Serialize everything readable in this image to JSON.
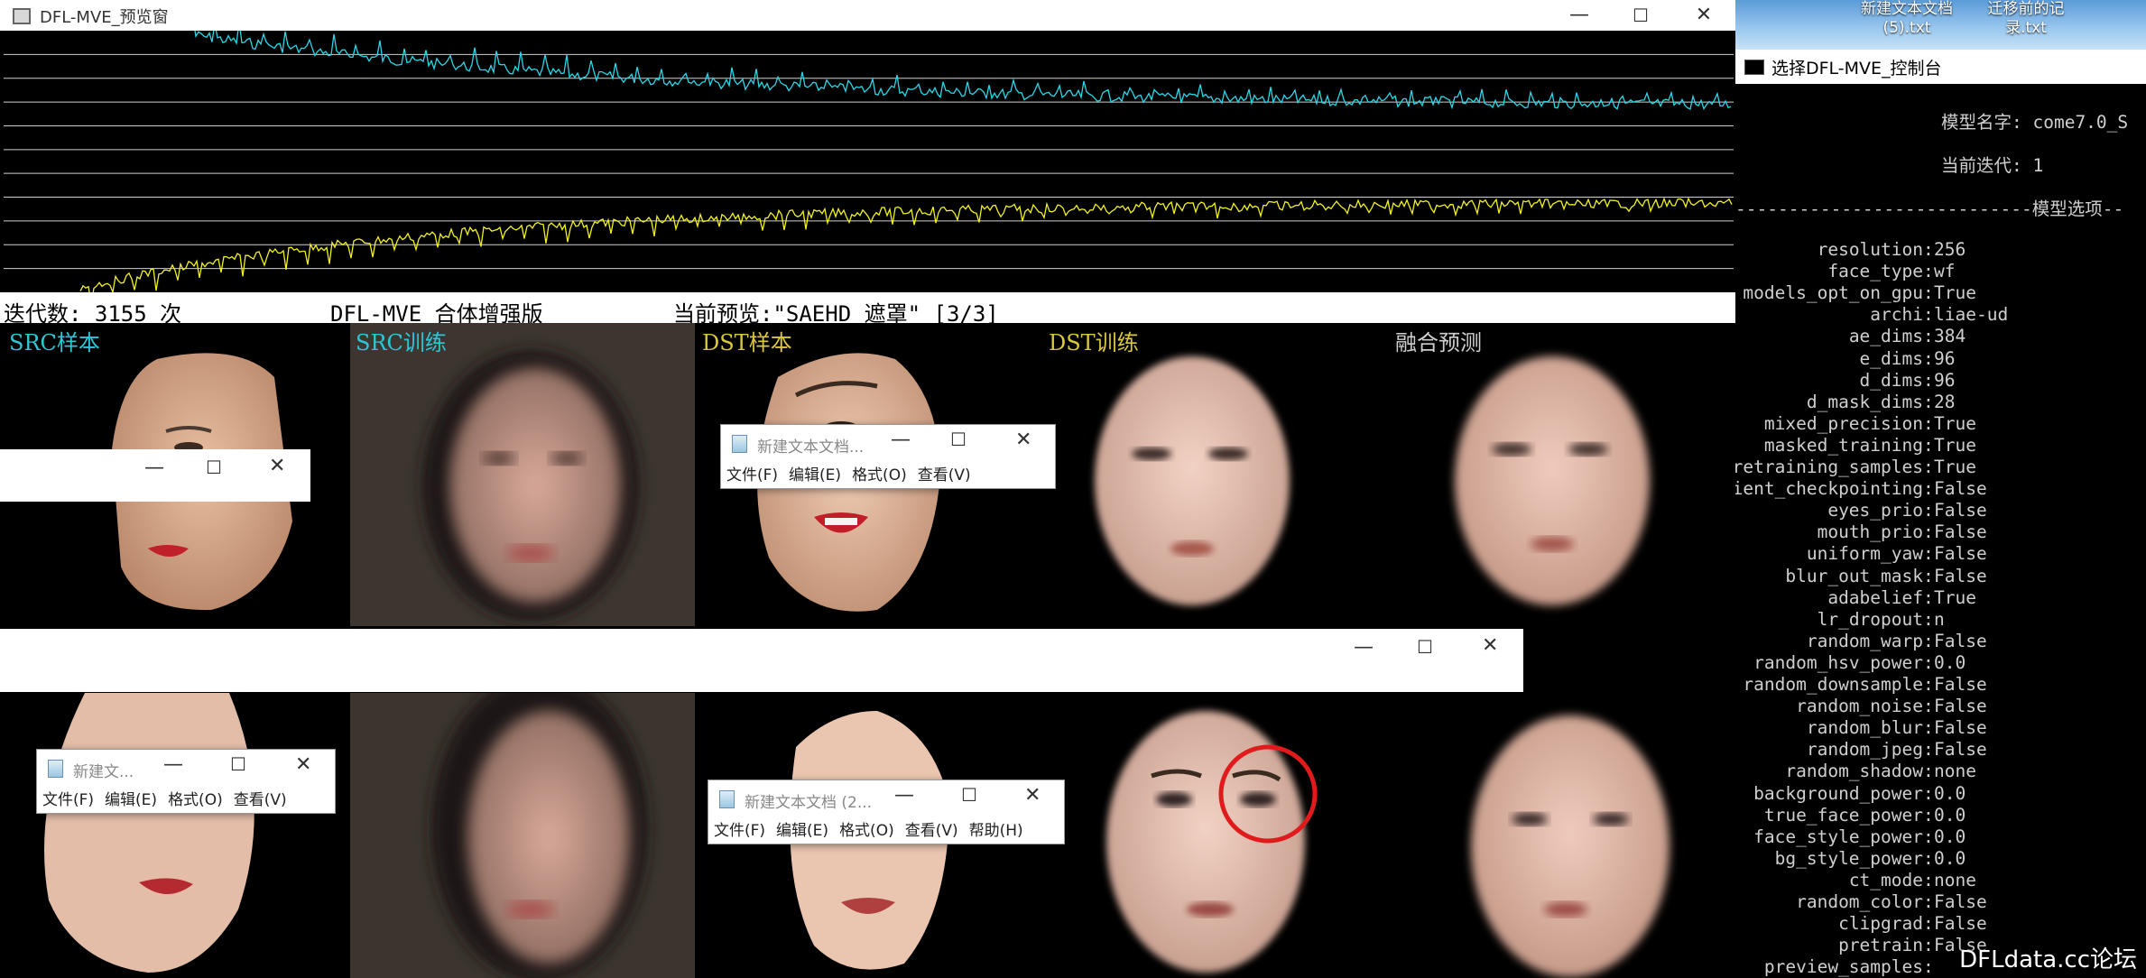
{
  "preview_window": {
    "title": "DFL-MVE_预览窗",
    "status": {
      "iterations": "迭代数: 3155 次",
      "edition": "DFL-MVE_合体增强版",
      "current_preview": "当前预览:\"SAEHD 遮罩\" [3/3]"
    },
    "columns": [
      {
        "label": "SRC样本",
        "color": "#2cc6d8"
      },
      {
        "label": "SRC训练",
        "color": "#2cc6d8"
      },
      {
        "label": "DST样本",
        "color": "#d9c83b"
      },
      {
        "label": "DST训练",
        "color": "#d9c83b"
      },
      {
        "label": "融合预测",
        "color": "#cfcfcf"
      }
    ],
    "graph": {
      "src_loss_color": "#27d8e8",
      "dst_loss_color": "#f2f21e",
      "gridlines": 10
    }
  },
  "console_window": {
    "title": "选择DFL-MVE_控制台",
    "model_name": "模型名字: come7.0_S",
    "current_iteration": "当前迭代: 1",
    "section_header": "----------------------------模型选项--",
    "options": [
      {
        "key": "resolution",
        "value": "256"
      },
      {
        "key": "face_type",
        "value": "wf"
      },
      {
        "key": "models_opt_on_gpu",
        "value": "True"
      },
      {
        "key": "archi",
        "value": "liae-ud"
      },
      {
        "key": "ae_dims",
        "value": "384"
      },
      {
        "key": "e_dims",
        "value": "96"
      },
      {
        "key": "d_dims",
        "value": "96"
      },
      {
        "key": "d_mask_dims",
        "value": "28"
      },
      {
        "key": "mixed_precision",
        "value": "True"
      },
      {
        "key": "masked_training",
        "value": "True"
      },
      {
        "key": "retraining_samples",
        "value": "True"
      },
      {
        "key": "gradient_checkpointing",
        "value": "False"
      },
      {
        "key": "eyes_prio",
        "value": "False"
      },
      {
        "key": "mouth_prio",
        "value": "False"
      },
      {
        "key": "uniform_yaw",
        "value": "False"
      },
      {
        "key": "blur_out_mask",
        "value": "False"
      },
      {
        "key": "adabelief",
        "value": "True"
      },
      {
        "key": "lr_dropout",
        "value": "n"
      },
      {
        "key": "random_warp",
        "value": "False"
      },
      {
        "key": "random_hsv_power",
        "value": "0.0"
      },
      {
        "key": "random_downsample",
        "value": "False"
      },
      {
        "key": "random_noise",
        "value": "False"
      },
      {
        "key": "random_blur",
        "value": "False"
      },
      {
        "key": "random_jpeg",
        "value": "False"
      },
      {
        "key": "random_shadow",
        "value": "none"
      },
      {
        "key": "background_power",
        "value": "0.0"
      },
      {
        "key": "true_face_power",
        "value": "0.0"
      },
      {
        "key": "face_style_power",
        "value": "0.0"
      },
      {
        "key": "bg_style_power",
        "value": "0.0"
      },
      {
        "key": "ct_mode",
        "value": "none"
      },
      {
        "key": "random_color",
        "value": "False"
      },
      {
        "key": "clipgrad",
        "value": "False"
      },
      {
        "key": "pretrain",
        "value": "False"
      },
      {
        "key": "preview_samples",
        "value": ""
      }
    ]
  },
  "notepads": [
    {
      "title": "新建文本文档...",
      "menu": [
        "文件(F)",
        "编辑(E)",
        "格式(O)",
        "查看(V)"
      ]
    },
    {
      "title": "新建文...",
      "menu": [
        "文件(F)",
        "编辑(E)",
        "格式(O)",
        "查看(V)"
      ]
    },
    {
      "title": "新建文本文档 (2...",
      "menu": [
        "文件(F)",
        "编辑(E)",
        "格式(O)",
        "查看(V)",
        "帮助(H)"
      ]
    }
  ],
  "window_controls": {
    "minimize": "—",
    "maximize": "☐",
    "close": "✕"
  },
  "desktop_files": [
    {
      "line1": "新建文本文档",
      "line2": "(5).txt"
    },
    {
      "line1": "迁移前的记",
      "line2": "录.txt"
    }
  ],
  "watermark": "DFLdata.cc论坛"
}
